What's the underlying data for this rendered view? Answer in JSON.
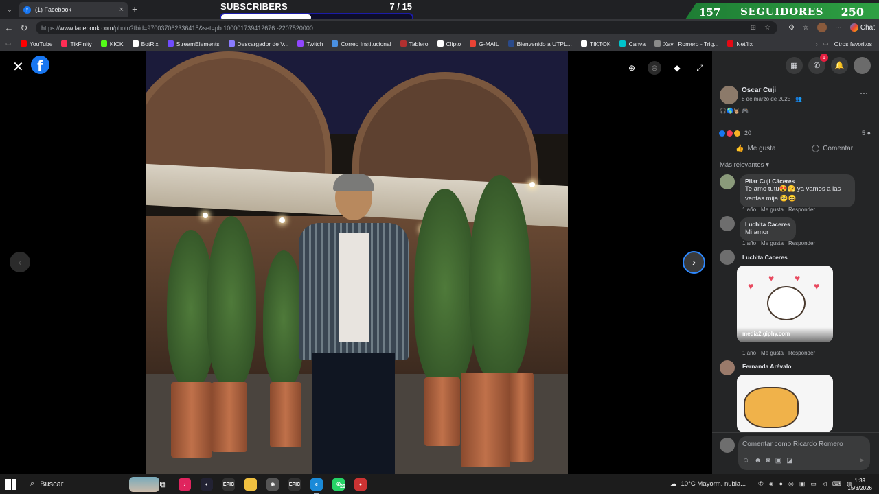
{
  "browser": {
    "tab_title": "(1) Facebook",
    "url_prefix": "https://",
    "url_domain": "www.facebook.com",
    "url_path": "/photo?fbid=970037062336415&set=pb.100001739412676.-2207520000",
    "chat_label": "Chat"
  },
  "overlay": {
    "subscribers_label": "SUBSCRIBERS",
    "subscribers_count": "7  / 15",
    "subscribers_progress": 0.47,
    "followers_current": "157",
    "followers_label": "SEGUIDORES",
    "followers_goal": "250"
  },
  "bookmarks": [
    {
      "label": "YouTube",
      "color": "#ff0000"
    },
    {
      "label": "TikFinity",
      "color": "#ff2d55"
    },
    {
      "label": "KICK",
      "color": "#53fc18"
    },
    {
      "label": "BotRix",
      "color": "#ffffff"
    },
    {
      "label": "StreamElements",
      "color": "#6f4cff"
    },
    {
      "label": "Descargador de V...",
      "color": "#8a7cff"
    },
    {
      "label": "Twitch",
      "color": "#9146ff"
    },
    {
      "label": "Correo Institucional",
      "color": "#4a90e2"
    },
    {
      "label": "Tablero",
      "color": "#b03030"
    },
    {
      "label": "Clipto",
      "color": "#ffffff"
    },
    {
      "label": "G-MAIL",
      "color": "#ea4335"
    },
    {
      "label": "Bienvenido a UTPL...",
      "color": "#2a4a8a"
    },
    {
      "label": "TIKTOK",
      "color": "#ffffff"
    },
    {
      "label": "Canva",
      "color": "#00c4cc"
    },
    {
      "label": "Xavi_Romero - Trig...",
      "color": "#8a8a8a"
    },
    {
      "label": "Netflix",
      "color": "#e50914"
    }
  ],
  "bookmarks_other": "Otros favoritos",
  "post": {
    "author": "Oscar Cuji",
    "date": "8 de marzo de 2025 · ",
    "reactions_count": "20",
    "comments_count": "5",
    "like_label": "Me gusta",
    "comment_label": "Comentar",
    "sort_label": "Más relevantes",
    "notification_count": "1"
  },
  "comments": [
    {
      "name": "Pilar Cuji Cáceres",
      "text": "Te amo tutu😍🤗 ya vamos a las ventas mija 🥺😄",
      "time": "1 año",
      "like": "Me gusta",
      "reply": "Responder"
    },
    {
      "name": "Luchita Caceres",
      "text": "Mi amor",
      "time": "1 año",
      "like": "Me gusta",
      "reply": "Responder"
    },
    {
      "name": "Luchita Caceres",
      "gif_source": "media2.giphy.com",
      "time": "1 año",
      "like": "Me gusta",
      "reply": "Responder"
    },
    {
      "name": "Fernanda Arévalo"
    }
  ],
  "composer_placeholder": "Comentar como Ricardo Romero",
  "taskbar": {
    "search_label": "Buscar",
    "whatsapp_badge": "29",
    "weather": "10°C  Mayorm. nubla...",
    "time": "1:39",
    "date": "15/3/2026"
  }
}
